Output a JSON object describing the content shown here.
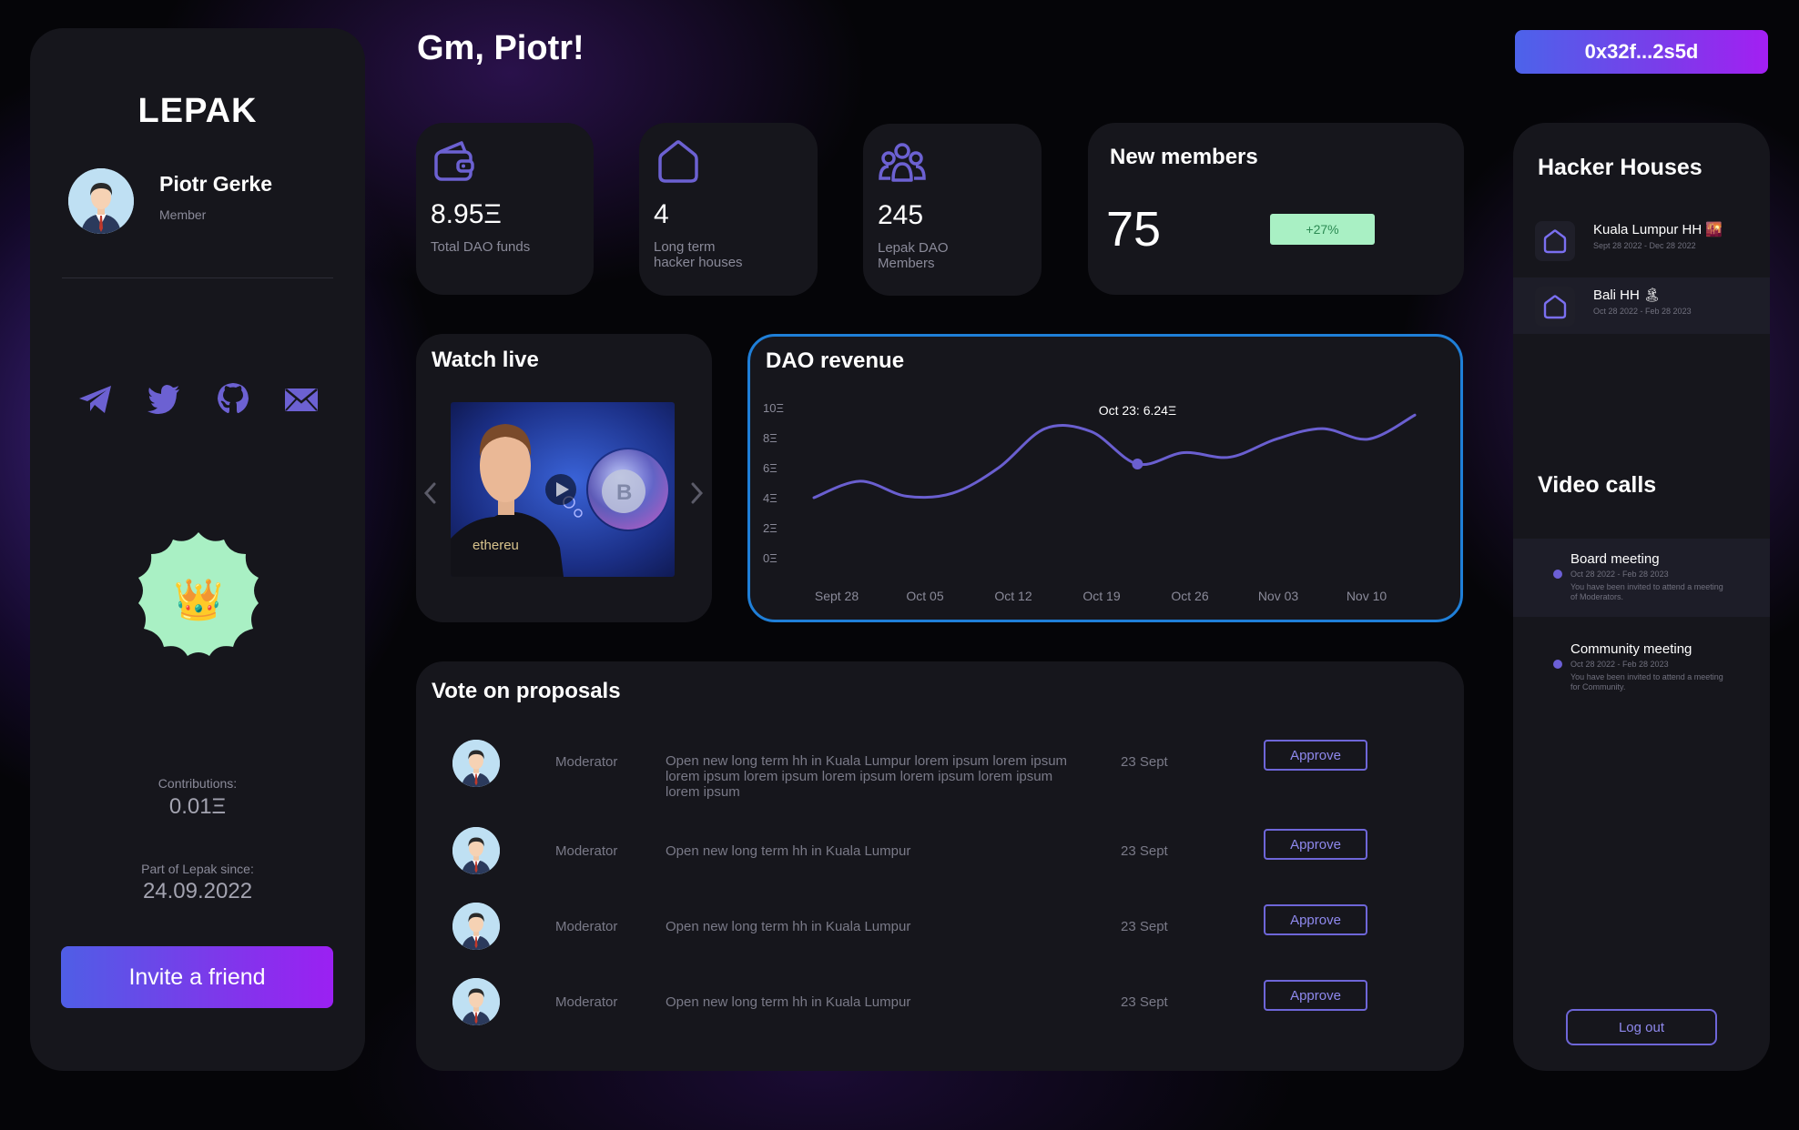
{
  "brand": "LEPAK",
  "user": {
    "name": "Piotr Gerke",
    "role": "Member"
  },
  "greeting": "Gm, Piotr!",
  "wallet": "0x32f...2s5d",
  "contributions": {
    "label": "Contributions:",
    "value": "0.01Ξ"
  },
  "member_since": {
    "label": "Part of Lepak since:",
    "value": "24.09.2022"
  },
  "invite_label": "Invite a friend",
  "badge_emoji": "👑",
  "socials": [
    "telegram-icon",
    "twitter-icon",
    "github-icon",
    "mail-icon"
  ],
  "stats": [
    {
      "icon": "wallet-icon",
      "value": "8.95Ξ",
      "label": "Total DAO funds"
    },
    {
      "icon": "house-icon",
      "value": "4",
      "label": "Long term hacker houses"
    },
    {
      "icon": "members-icon",
      "value": "245",
      "label": "Lepak DAO Members"
    }
  ],
  "new_members": {
    "title": "New members",
    "value": "75",
    "change": "+27%"
  },
  "watch_live": {
    "title": "Watch live"
  },
  "revenue": {
    "title": "DAO revenue",
    "tooltip": "Oct 23: 6.24Ξ"
  },
  "chart_data": {
    "type": "line",
    "title": "DAO revenue",
    "x": [
      "Sept 28",
      "Oct 05",
      "Oct 12",
      "Oct 19",
      "Oct 26",
      "Nov 03",
      "Nov 10"
    ],
    "yticks": [
      "0Ξ",
      "2Ξ",
      "4Ξ",
      "6Ξ",
      "8Ξ",
      "10Ξ"
    ],
    "ylim": [
      0,
      10
    ],
    "series": [
      {
        "values": [
          4.0,
          5.1,
          4.1,
          4.3,
          6.0,
          8.6,
          8.4,
          6.24,
          7.0,
          6.7,
          7.9,
          8.6,
          7.9,
          9.5
        ]
      }
    ],
    "highlight": {
      "label": "Oct 23: 6.24Ξ",
      "index": 7,
      "value": 6.24
    },
    "grid": false
  },
  "proposals": {
    "title": "Vote on proposals",
    "rows": [
      {
        "role": "Moderator",
        "text": "Open new long term hh in Kuala Lumpur lorem ipsum lorem ipsum  lorem ipsum  lorem ipsum  lorem ipsum  lorem ipsum lorem ipsum  lorem ipsum",
        "date": "23 Sept",
        "action": "Approve"
      },
      {
        "role": "Moderator",
        "text": "Open new long term hh in Kuala Lumpur",
        "date": "23 Sept",
        "action": "Approve"
      },
      {
        "role": "Moderator",
        "text": "Open new long term hh in Kuala Lumpur",
        "date": "23 Sept",
        "action": "Approve"
      },
      {
        "role": "Moderator",
        "text": "Open new long term hh in Kuala Lumpur",
        "date": "23 Sept",
        "action": "Approve"
      }
    ]
  },
  "hacker_houses": {
    "title": "Hacker Houses",
    "items": [
      {
        "name": "Kuala Lumpur HH 🌇",
        "dates": "Sept 28 2022 - Dec 28 2022"
      },
      {
        "name": "Bali HH 🏝",
        "dates": "Oct 28 2022 - Feb 28 2023"
      }
    ]
  },
  "video_calls": {
    "title": "Video calls",
    "items": [
      {
        "name": "Board meeting",
        "dates": "Oct 28 2022 - Feb 28 2023",
        "note": "You have been invited to attend a meeting of Moderators."
      },
      {
        "name": "Community meeting",
        "dates": "Oct 28 2022 - Feb 28 2023",
        "note": "You have been invited to attend a meeting for Community."
      }
    ]
  },
  "logout_label": "Log out",
  "colors": {
    "accent": "#6e66d8",
    "chart_line": "#6a5fd0",
    "chart_border": "#1f7fd8",
    "badge": "#a9f0c4"
  }
}
